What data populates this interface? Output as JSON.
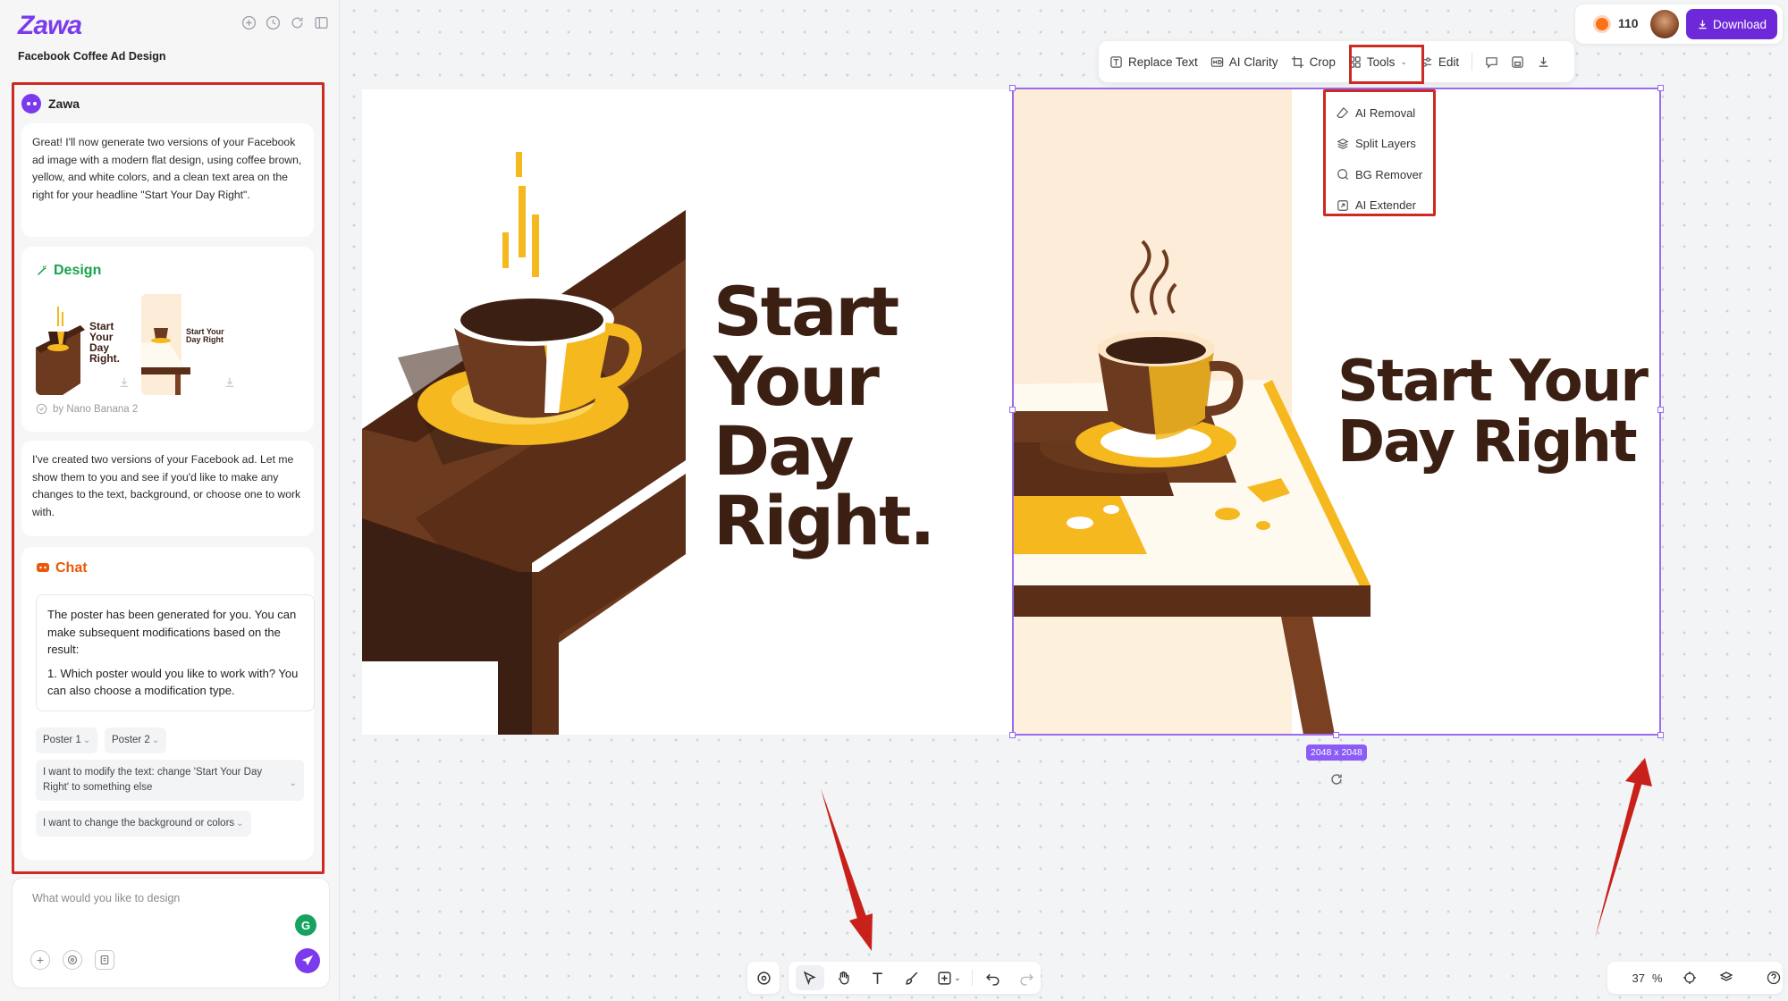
{
  "sidebar": {
    "logo": "Zawa",
    "project_title": "Facebook Coffee Ad Design",
    "assistant_name": "Zawa",
    "intro_message": "Great! I'll now generate two versions of your Facebook ad image with a modern flat design, using coffee brown, yellow, and white colors, and a clean text area on the right for your headline \"Start Your Day Right\".",
    "design_title": "Design",
    "thumb1_text": "Start Your Day Right.",
    "thumb2_text": "Start Your Day Right",
    "design_credit": "by Nano Banana 2",
    "followup_message": "I've created two versions of your Facebook ad. Let me show them to you and see if you'd like to make any changes to the text, background, or choose one to work with.",
    "chat_title": "Chat",
    "chat_message_1": "The poster has been generated for you. You can make subsequent modifications based on the result:",
    "chat_message_2": "1. Which poster would you like to work with? You can also choose a modification type.",
    "options": [
      "Poster 1",
      "Poster 2"
    ],
    "suggestion_1": "I want to modify the text: change 'Start Your Day Right' to something else",
    "suggestion_2": "I want to change the background or colors",
    "input_placeholder": "What would you like to design"
  },
  "canvas": {
    "poster1_headline": [
      "Start",
      "Your",
      "Day",
      "Right."
    ],
    "poster2_headline": [
      "Start Your",
      "Day Right"
    ],
    "selection_size": "2048 x 2048"
  },
  "toolbar": {
    "replace_text": "Replace Text",
    "ai_clarity": "AI Clarity",
    "crop": "Crop",
    "tools": "Tools",
    "edit": "Edit"
  },
  "tools_menu": [
    "AI Removal",
    "Split Layers",
    "BG Remover",
    "AI Extender"
  ],
  "top_right": {
    "credits": "110",
    "download_label": "Download"
  },
  "zoom": {
    "value": "37",
    "unit": "%"
  },
  "colors": {
    "accent": "#7c3aed",
    "highlight_box": "#cc2a22",
    "coffee_brown": "#5a2e17",
    "coffee_yellow": "#f5b81f"
  }
}
